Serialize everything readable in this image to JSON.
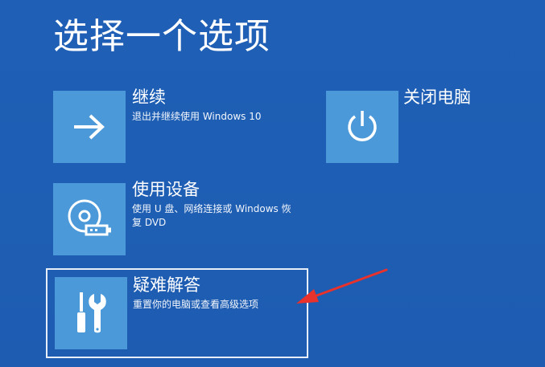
{
  "page": {
    "title": "选择一个选项"
  },
  "options": {
    "continue": {
      "title": "继续",
      "description": "退出并继续使用 Windows 10",
      "icon": "arrow-right-icon"
    },
    "use_device": {
      "title": "使用设备",
      "description": "使用 U 盘、网络连接或 Windows 恢复 DVD",
      "icon": "disc-usb-icon"
    },
    "troubleshoot": {
      "title": "疑难解答",
      "description": "重置你的电脑或查看高级选项",
      "icon": "screwdriver-wrench-icon"
    },
    "shutdown": {
      "title": "关闭电脑",
      "icon": "power-icon"
    }
  },
  "colors": {
    "background": "#1f60b6",
    "tile": "#4c99d9",
    "text": "#ffffff",
    "annotation": "#e8322b"
  }
}
